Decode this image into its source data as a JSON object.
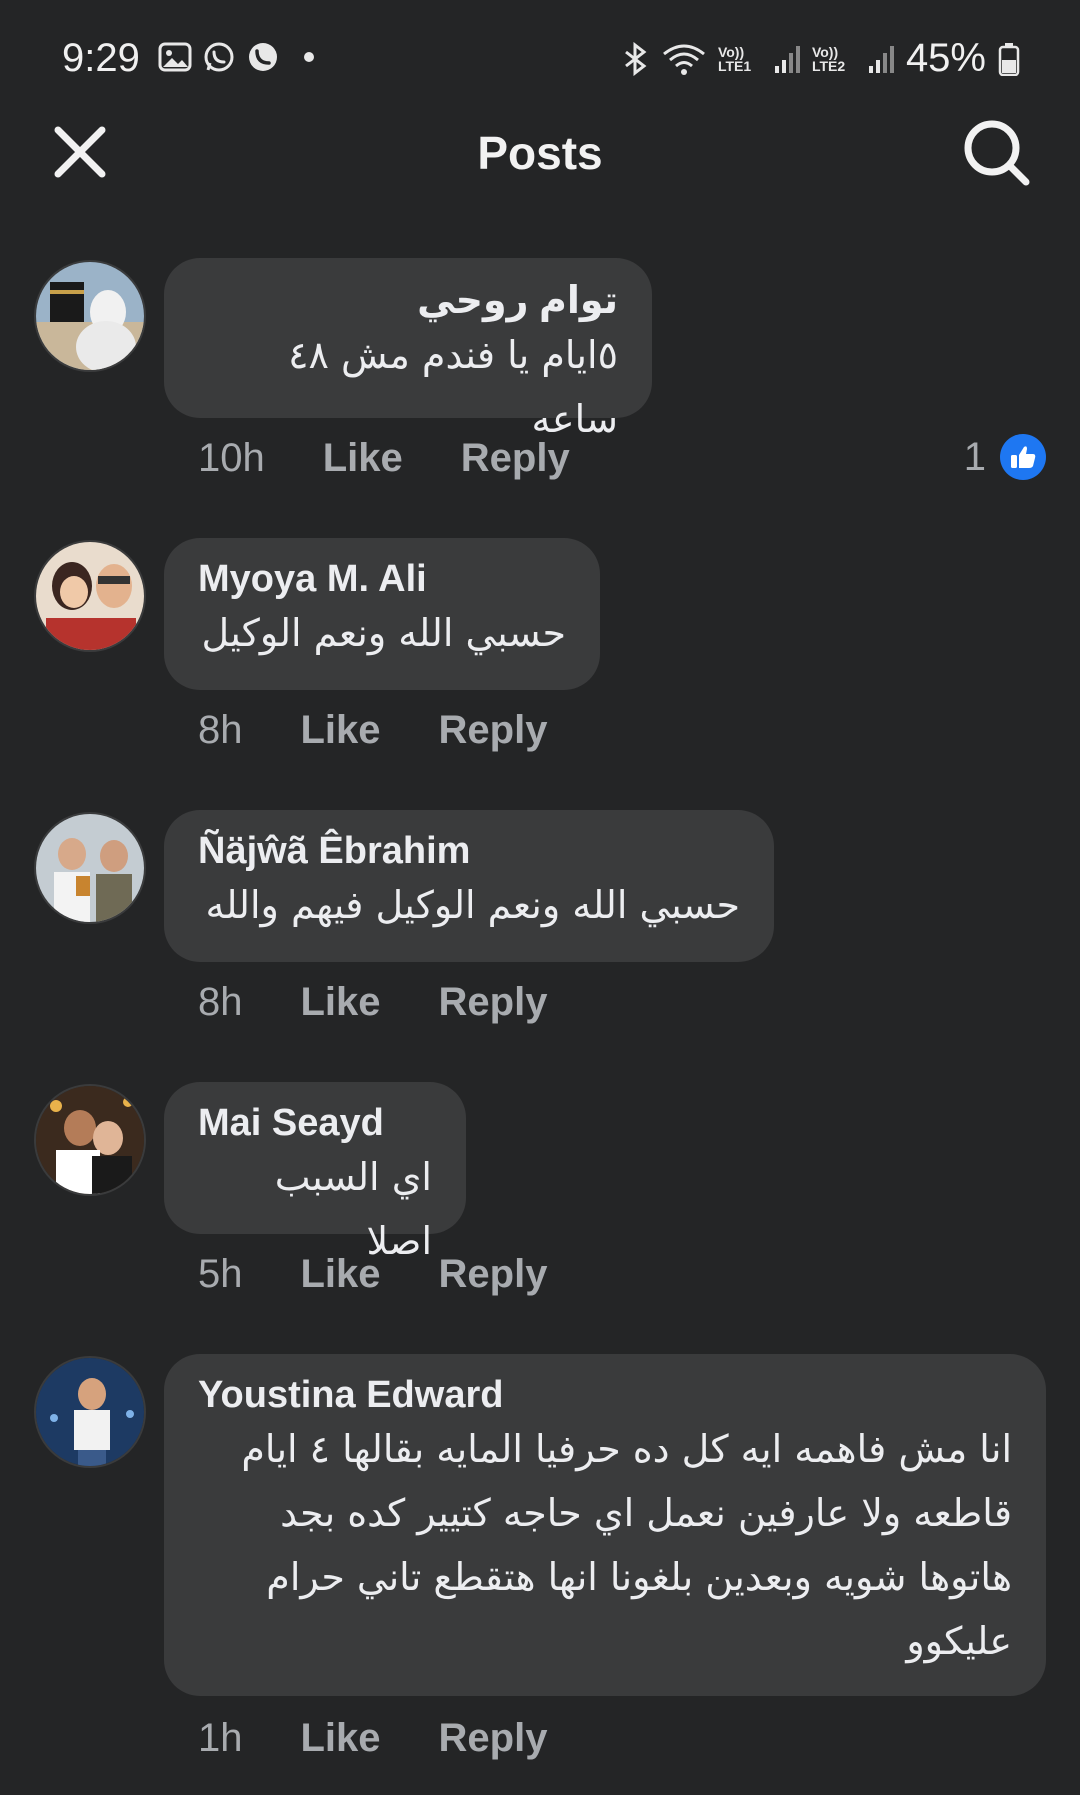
{
  "status_bar": {
    "time": "9:29",
    "battery": "45%",
    "network1": "Vo)) LTE1",
    "network2": "Vo)) LTE2"
  },
  "header": {
    "title": "Posts"
  },
  "colors": {
    "background": "#242526",
    "bubble": "#3a3b3c",
    "like_blue": "#1e77f2"
  },
  "comments": [
    {
      "author": "توام روحي",
      "text": "٥ايام يا فندم مش ٤٨ ساعه",
      "time": "10h",
      "like": "Like",
      "reply": "Reply",
      "reaction_count": "1"
    },
    {
      "author": "Myoya M. Ali",
      "text": "حسبي الله ونعم الوكيل",
      "time": "8h",
      "like": "Like",
      "reply": "Reply"
    },
    {
      "author": "Ñäjŵã Êbrahim",
      "text": "حسبي الله ونعم الوكيل فيهم والله",
      "time": "8h",
      "like": "Like",
      "reply": "Reply"
    },
    {
      "author": "Mai Seayd",
      "text": "اي السبب اصلا",
      "time": "5h",
      "like": "Like",
      "reply": "Reply"
    },
    {
      "author": "Youstina Edward",
      "text": "انا مش فاهمه ايه كل ده حرفيا المايه بقالها ٤ ايام قاطعه ولا عارفين نعمل اي حاجه كتيير كده بجد هاتوها شويه وبعدين بلغونا انها هتقطع تاني حرام عليكوو",
      "time": "1h",
      "like": "Like",
      "reply": "Reply"
    }
  ]
}
